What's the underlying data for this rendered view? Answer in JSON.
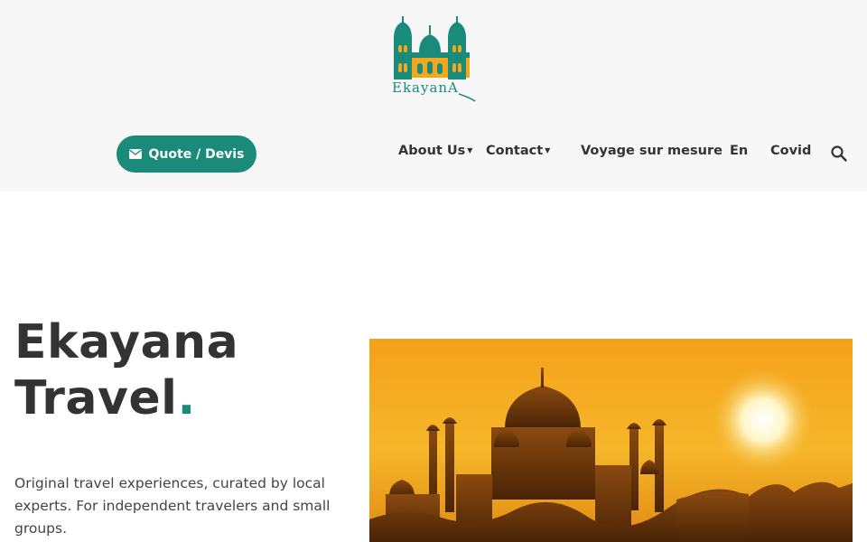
{
  "brand": {
    "logo_text": "EkayanA",
    "accent": "#1a8a7a",
    "gold": "#f2a81d"
  },
  "header": {
    "quote_button": {
      "label": "Quote / Devis",
      "icon": "envelope-icon"
    },
    "nav": [
      {
        "label": "About Us",
        "has_dropdown": true
      },
      {
        "label": "Contact",
        "has_dropdown": true
      },
      {
        "label": "Voyage sur mesure",
        "has_dropdown": false
      },
      {
        "label": "En",
        "has_dropdown": false
      },
      {
        "label": "Covid",
        "has_dropdown": false
      }
    ],
    "search_icon": "search-icon"
  },
  "hero": {
    "title_line1": "Ekayana",
    "title_line2": "Travel",
    "title_dot": ".",
    "description": "Original travel experiences, curated by local experts. For independent travelers and small groups.",
    "image": "taj-mahal-sunset-image"
  }
}
